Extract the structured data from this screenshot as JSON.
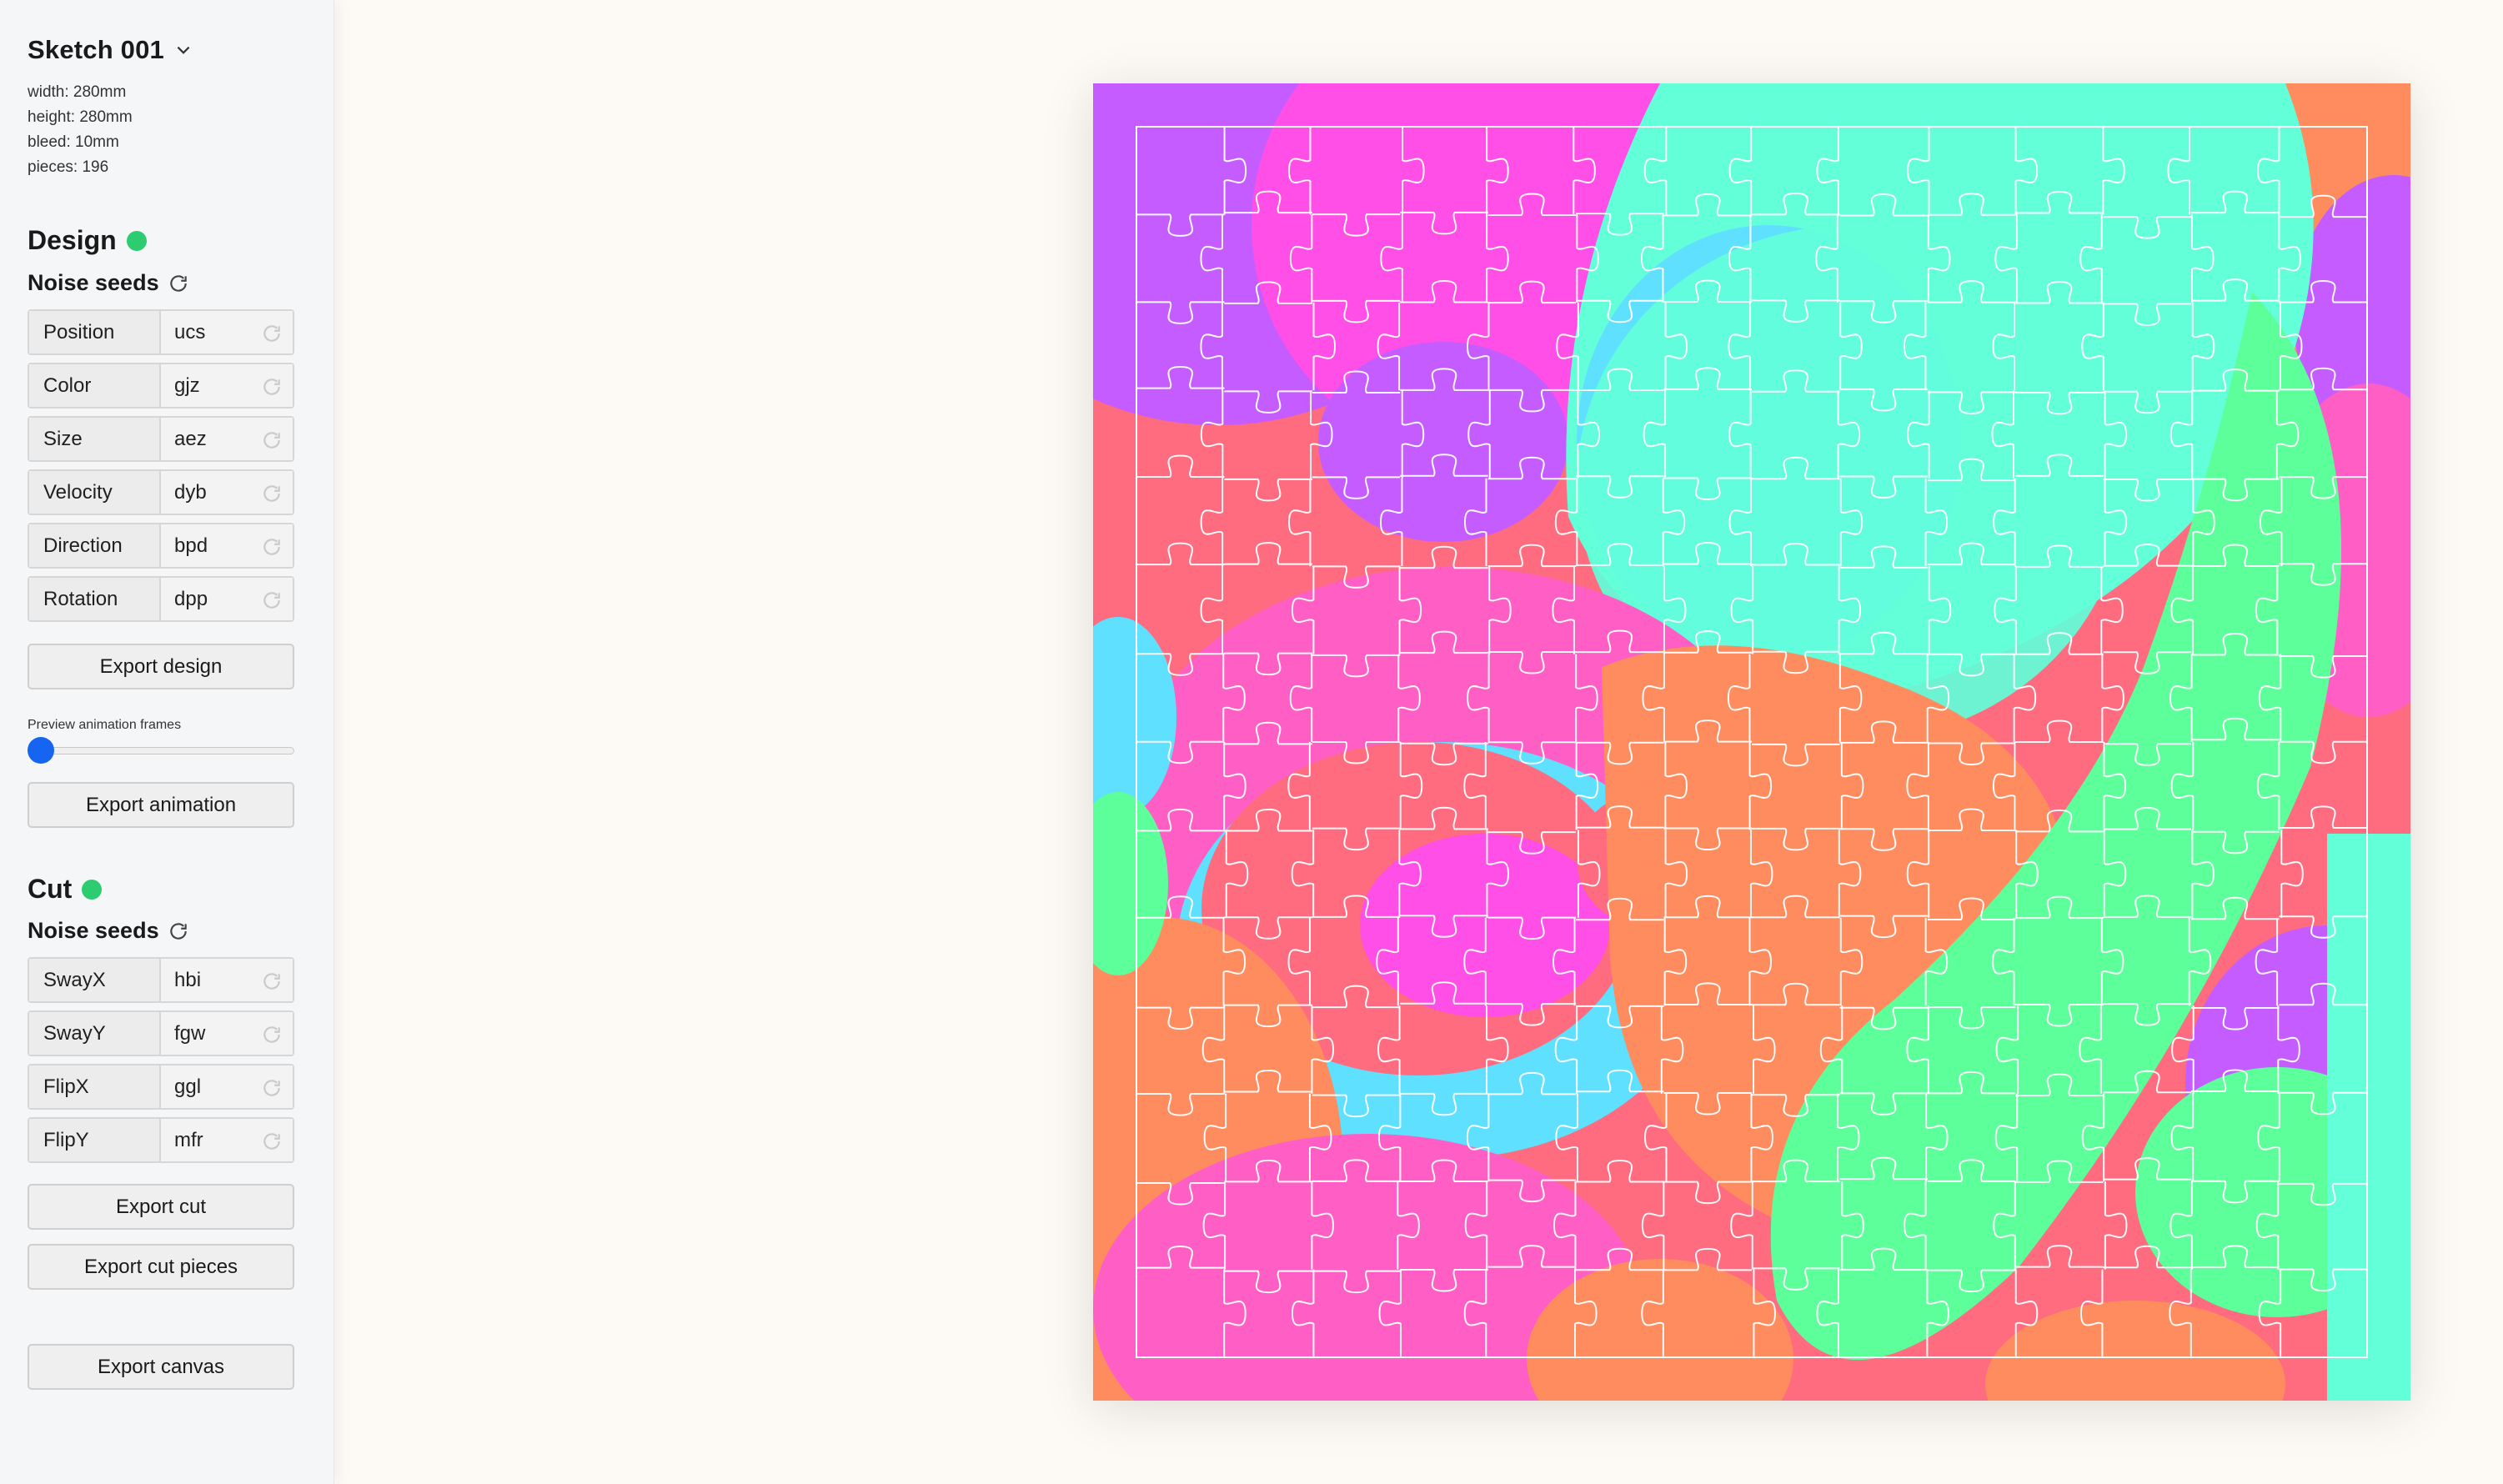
{
  "sketch": {
    "title": "Sketch 001",
    "meta": [
      "width: 280mm",
      "height: 280mm",
      "bleed: 10mm",
      "pieces: 196"
    ]
  },
  "design": {
    "heading": "Design",
    "status_color": "#2ecc71",
    "noise_heading": "Noise seeds",
    "seeds": [
      {
        "label": "Position",
        "value": "ucs"
      },
      {
        "label": "Color",
        "value": "gjz"
      },
      {
        "label": "Size",
        "value": "aez"
      },
      {
        "label": "Velocity",
        "value": "dyb"
      },
      {
        "label": "Direction",
        "value": "bpd"
      },
      {
        "label": "Rotation",
        "value": "dpp"
      }
    ],
    "export_design": "Export design",
    "preview_label": "Preview animation frames",
    "preview_value": 0,
    "export_animation": "Export animation"
  },
  "cut": {
    "heading": "Cut",
    "status_color": "#2ecc71",
    "noise_heading": "Noise seeds",
    "seeds": [
      {
        "label": "SwayX",
        "value": "hbi"
      },
      {
        "label": "SwayY",
        "value": "fgw"
      },
      {
        "label": "FlipX",
        "value": "ggl"
      },
      {
        "label": "FlipY",
        "value": "mfr"
      }
    ],
    "export_cut": "Export cut",
    "export_cut_pieces": "Export cut pieces"
  },
  "export_canvas": "Export canvas",
  "palette": {
    "purple": "#c55cff",
    "magenta": "#ff4fe6",
    "mint": "#62ffd9",
    "cyan": "#5fe0ff",
    "salmon": "#ff6b7f",
    "orange": "#ff8c5f",
    "green": "#5dff9a",
    "pink": "#ff5fc4",
    "accent": "#1565f0"
  }
}
